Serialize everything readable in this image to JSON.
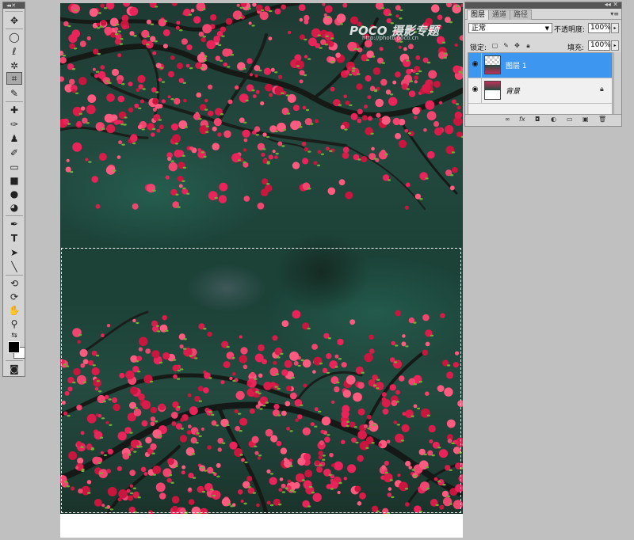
{
  "toolbox": {
    "header": "◂◂ ✕",
    "tools": [
      {
        "name": "move-tool-icon",
        "glyph": "✥"
      },
      {
        "name": "marquee-tool-icon",
        "glyph": "◯"
      },
      {
        "name": "lasso-tool-icon",
        "glyph": "ℓ"
      },
      {
        "name": "magic-wand-tool-icon",
        "glyph": "✲"
      },
      {
        "name": "crop-tool-icon",
        "glyph": "⌗"
      },
      {
        "name": "eyedropper-tool-icon",
        "glyph": "✎"
      },
      {
        "name": "healing-brush-tool-icon",
        "glyph": "✚"
      },
      {
        "name": "brush-tool-icon",
        "glyph": "✑"
      },
      {
        "name": "clone-stamp-tool-icon",
        "glyph": "♟"
      },
      {
        "name": "history-brush-tool-icon",
        "glyph": "✐"
      },
      {
        "name": "eraser-tool-icon",
        "glyph": "▭"
      },
      {
        "name": "gradient-tool-icon",
        "glyph": "■"
      },
      {
        "name": "blur-tool-icon",
        "glyph": "●"
      },
      {
        "name": "dodge-tool-icon",
        "glyph": "◕"
      },
      {
        "name": "pen-tool-icon",
        "glyph": "✒"
      },
      {
        "name": "type-tool-icon",
        "glyph": "T"
      },
      {
        "name": "path-selection-tool-icon",
        "glyph": "➤"
      },
      {
        "name": "line-tool-icon",
        "glyph": "╲"
      },
      {
        "name": "3d-rotate-tool-icon",
        "glyph": "⟲"
      },
      {
        "name": "3d-orbit-tool-icon",
        "glyph": "⟳"
      },
      {
        "name": "hand-tool-icon",
        "glyph": "✋"
      },
      {
        "name": "zoom-tool-icon",
        "glyph": "⚲"
      },
      {
        "name": "swap-colors-icon",
        "glyph": "⇆"
      },
      {
        "name": "quick-mask-icon",
        "glyph": "◙"
      }
    ]
  },
  "canvas": {
    "watermark": "POCO 摄影专题",
    "watermark_url": "http://photo.poco.cn"
  },
  "layers_panel": {
    "header": "◂◂ ✕",
    "tabs": [
      "图层",
      "通道",
      "路径"
    ],
    "active_tab": "图层",
    "menu_icon": "▾≡",
    "blend_mode": "正常",
    "opacity_label": "不透明度:",
    "opacity_value": "100%",
    "lock_label": "锁定:",
    "fill_label": "填充:",
    "fill_value": "100%",
    "layers": [
      {
        "name": "图层 1",
        "selected": true,
        "locked": false
      },
      {
        "name": "背景",
        "selected": false,
        "locked": true
      }
    ],
    "footer_icons": [
      "link-icon",
      "fx-icon",
      "mask-icon",
      "adjustment-icon",
      "group-icon",
      "new-layer-icon",
      "trash-icon"
    ]
  },
  "colors": {
    "selected_layer": "#3d96f0",
    "workspace": "#c0c0c0",
    "blossom": "#e8245a"
  }
}
